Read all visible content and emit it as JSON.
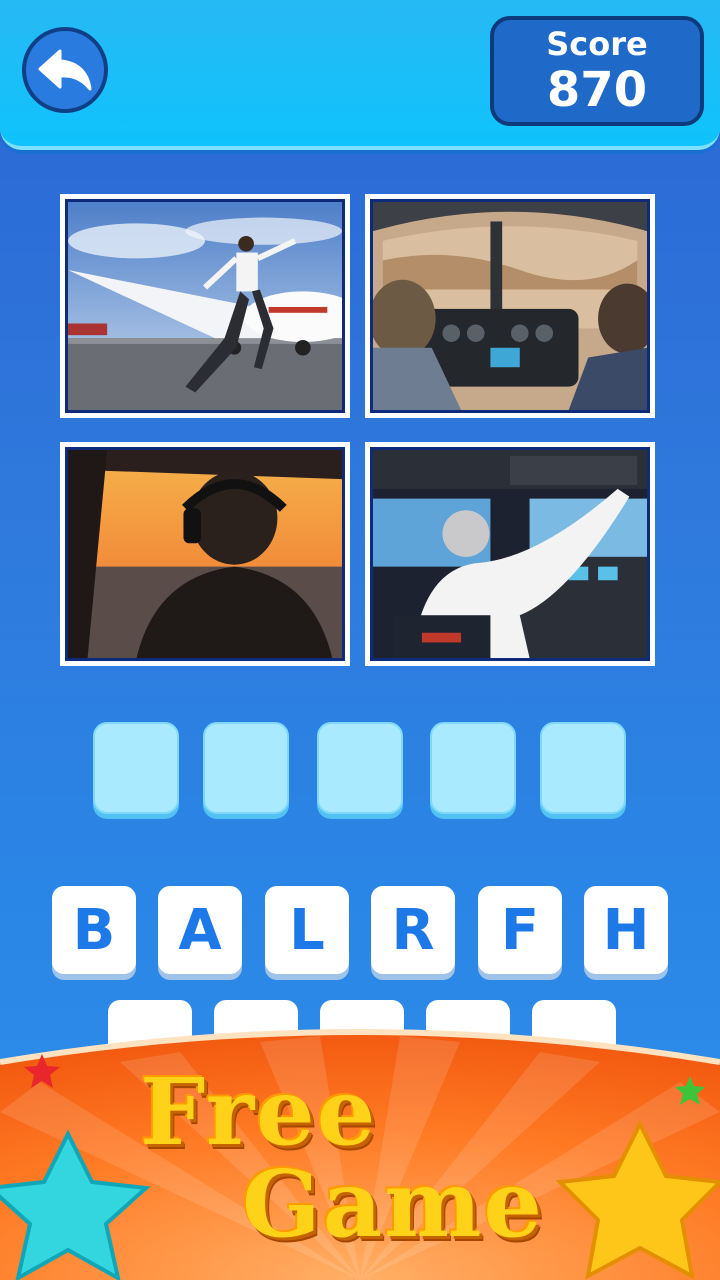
{
  "header": {
    "back_icon": "back-arrow-icon",
    "score_label": "Score",
    "score_value": "870"
  },
  "photos": [
    {
      "name": "pilot-jumping-by-plane"
    },
    {
      "name": "helicopter-cockpit"
    },
    {
      "name": "pilot-sunset-view"
    },
    {
      "name": "airliner-cockpit-pilot"
    }
  ],
  "answer_slots": [
    "",
    "",
    "",
    "",
    ""
  ],
  "letters_row1": [
    "B",
    "A",
    "L",
    "R",
    "F",
    "H"
  ],
  "banner": {
    "line1": "Free",
    "line2": "Game"
  },
  "colors": {
    "accent": "#1e79e8",
    "banner_orange": "#ff6a1a",
    "title_yellow": "#ffd21a"
  }
}
